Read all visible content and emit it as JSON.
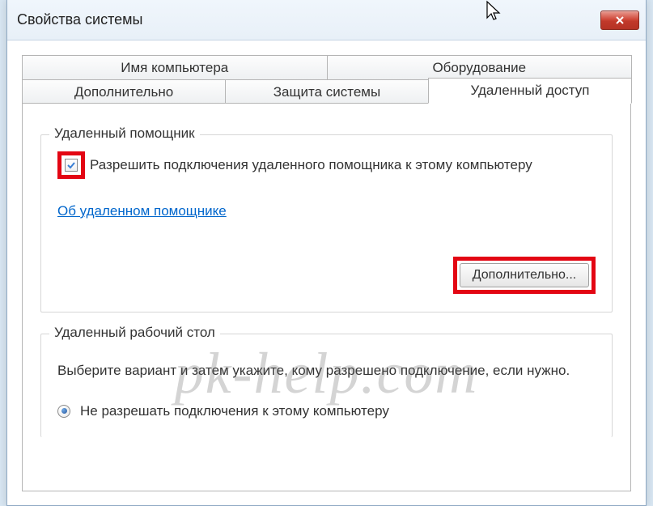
{
  "window": {
    "title": "Свойства системы"
  },
  "tabs": {
    "row1": [
      {
        "label": "Имя компьютера"
      },
      {
        "label": "Оборудование"
      }
    ],
    "row2": [
      {
        "label": "Дополнительно"
      },
      {
        "label": "Защита системы"
      },
      {
        "label": "Удаленный доступ"
      }
    ]
  },
  "remote_assist": {
    "legend": "Удаленный помощник",
    "checkbox_label": "Разрешить подключения удаленного помощника к этому компьютеру",
    "link": "Об удаленном помощнике",
    "advanced_button": "Дополнительно..."
  },
  "remote_desktop": {
    "legend": "Удаленный рабочий стол",
    "description": "Выберите вариант и затем укажите, кому разрешено подключение, если нужно.",
    "radio1": "Не разрешать подключения к этому компьютеру"
  },
  "watermark": "pk-help.com"
}
